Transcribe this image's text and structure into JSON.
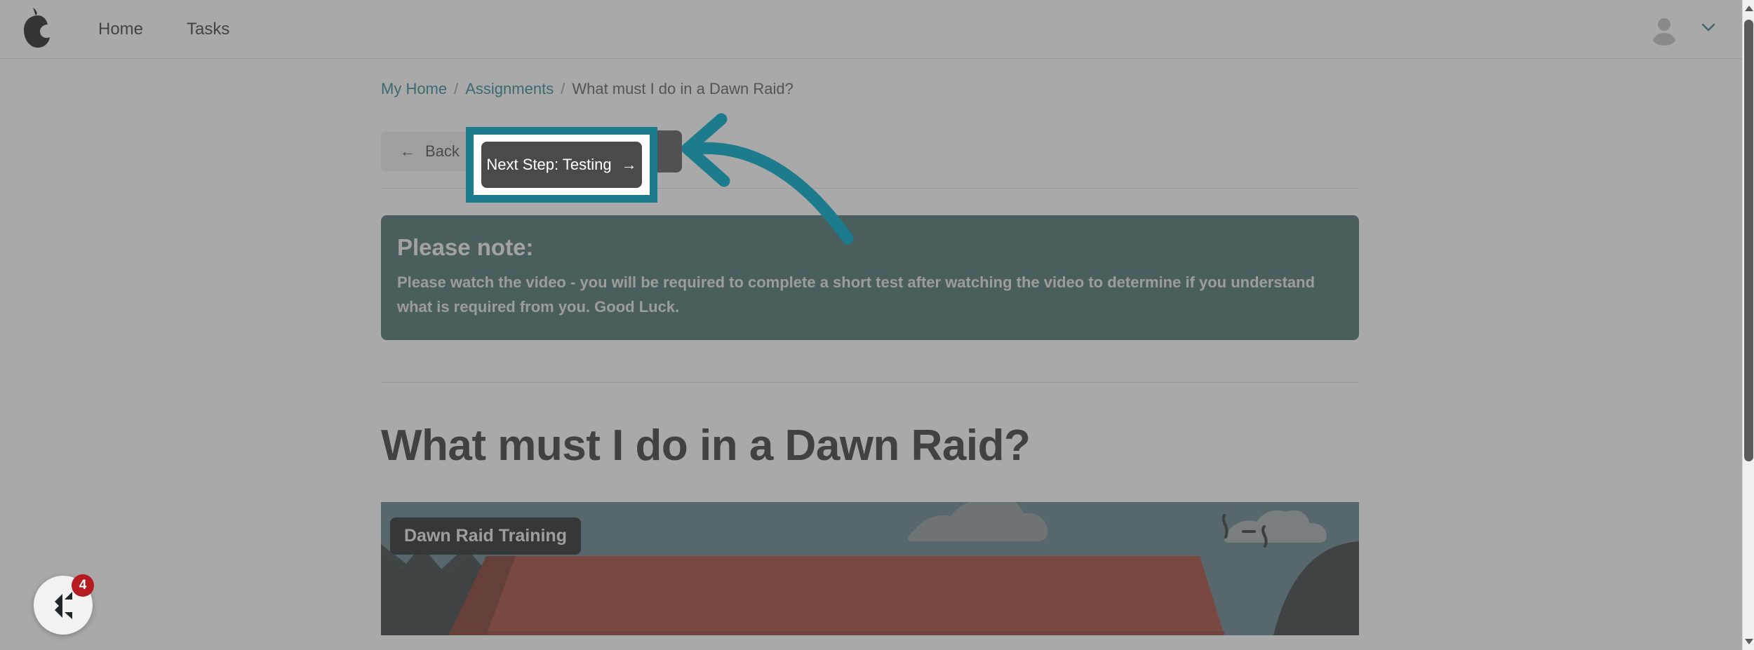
{
  "navbar": {
    "logo_name": "pear-logo-icon",
    "links": [
      {
        "label": "Home",
        "name": "nav-link-home"
      },
      {
        "label": "Tasks",
        "name": "nav-link-tasks"
      }
    ],
    "user_menu": {
      "avatar_alt": "user-avatar",
      "chevron": "chevron-down-icon"
    }
  },
  "breadcrumb": {
    "items": [
      {
        "label": "My Home",
        "link": true
      },
      {
        "label": "Assignments",
        "link": true
      },
      {
        "label": "What must I do in a Dawn Raid?",
        "link": false
      }
    ],
    "separator": "/"
  },
  "step_nav": {
    "back_label": "Back",
    "back_arrow": "←",
    "next_label": "Next Step: Testing",
    "next_arrow": "→"
  },
  "note": {
    "title": "Please note:",
    "body": "Please watch the video - you will be required to complete a short test after watching the video to determine if you understand what is required from you. Good Luck."
  },
  "main": {
    "title": "What must I do in a Dawn Raid?"
  },
  "video": {
    "title_badge": "Dawn Raid Training"
  },
  "chat_widget": {
    "badge_count": "4",
    "icon_name": "chat-bubble-icon"
  },
  "tour": {
    "highlight_target": "next-step-button",
    "arrow_name": "curved-arrow-annotation",
    "highlight_color": "#1c7b8c",
    "next_label": "Next Step: Testing",
    "next_arrow": "→"
  },
  "colors": {
    "accent_teal": "#1c7b8c",
    "note_bg": "#396362",
    "button_dark": "#4a4a4a",
    "badge_red": "#b71b22",
    "overlay": "rgba(90,90,90,0.52)"
  }
}
